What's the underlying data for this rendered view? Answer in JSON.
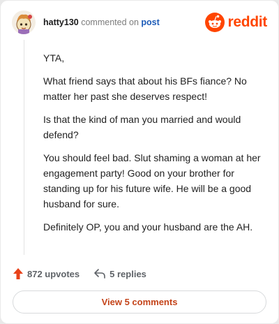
{
  "header": {
    "username": "hatty130",
    "action_text": "commented on",
    "post_link": "post",
    "brand": "reddit"
  },
  "comment": {
    "paragraphs": [
      "YTA,",
      "What friend says that about his BFs fiance? No matter her past she deserves respect!",
      "Is that the kind of man you married and would defend?",
      "You should feel bad. Slut shaming a woman at her engagement party! Good on your brother for standing up for his future wife. He will be a good husband for sure.",
      "Definitely OP, you and your husband are the AH."
    ]
  },
  "actions": {
    "upvotes_label": "872 upvotes",
    "replies_label": "5 replies",
    "view_comments_label": "View 5 comments"
  },
  "icons": {
    "upvote": "upvote-arrow-icon",
    "reply": "reply-arrow-icon",
    "brand": "reddit-snoo-icon"
  },
  "colors": {
    "brand_orange": "#ff4500",
    "upvote_orange": "#e8421a",
    "link_blue": "#1c5bb8",
    "button_text": "#c4441a"
  }
}
